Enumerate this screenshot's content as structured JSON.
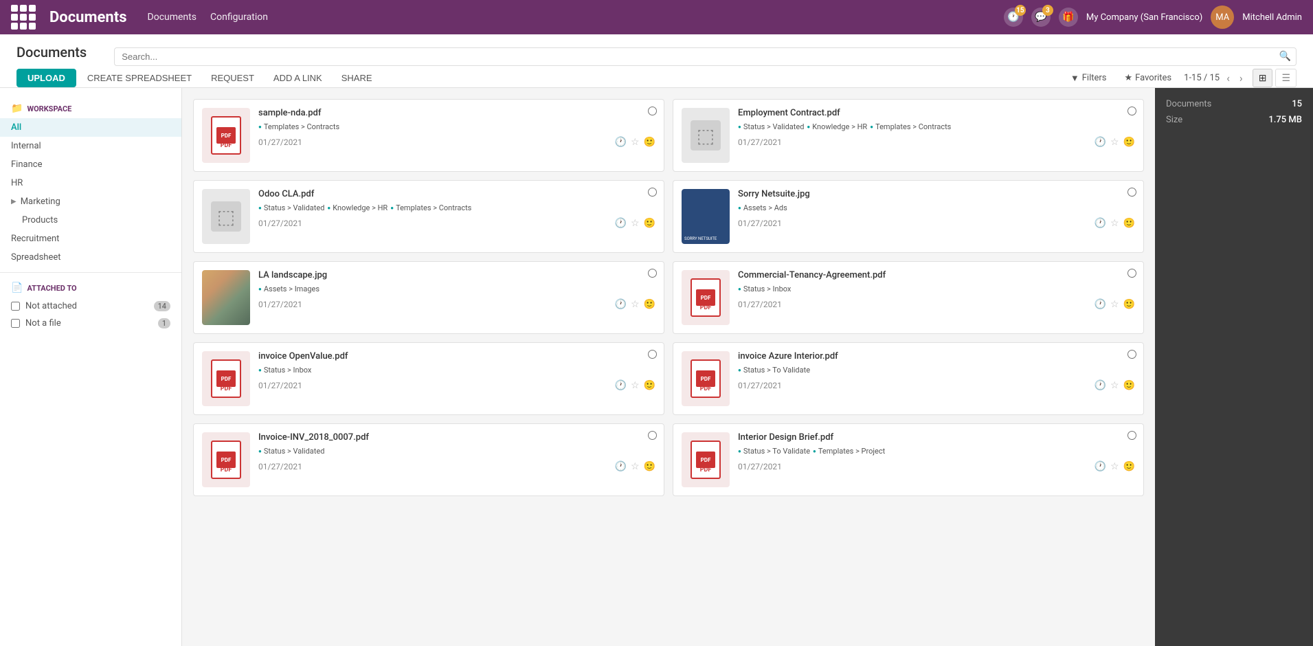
{
  "app": {
    "title": "Documents",
    "nav_links": [
      "Documents",
      "Configuration"
    ]
  },
  "topnav": {
    "company": "My Company (San Francisco)",
    "username": "Mitchell Admin",
    "badge1_count": "15",
    "badge2_count": "3"
  },
  "page": {
    "title": "Documents",
    "search_placeholder": "Search..."
  },
  "toolbar": {
    "upload_label": "UPLOAD",
    "create_spreadsheet_label": "CREATE SPREADSHEET",
    "request_label": "REQUEST",
    "add_link_label": "ADD A LINK",
    "share_label": "SHARE",
    "filters_label": "Filters",
    "favorites_label": "Favorites",
    "pagination": "1-15 / 15"
  },
  "sidebar": {
    "workspace_title": "WORKSPACE",
    "items": [
      {
        "label": "All",
        "active": true
      },
      {
        "label": "Internal",
        "active": false
      },
      {
        "label": "Finance",
        "active": false
      },
      {
        "label": "HR",
        "active": false
      },
      {
        "label": "Marketing",
        "active": false,
        "has_arrow": true
      },
      {
        "label": "Products",
        "active": false
      },
      {
        "label": "Recruitment",
        "active": false
      },
      {
        "label": "Spreadsheet",
        "active": false
      }
    ],
    "attached_to_title": "ATTACHED TO",
    "attached_items": [
      {
        "label": "Not attached",
        "count": "14"
      },
      {
        "label": "Not a file",
        "count": "1"
      }
    ]
  },
  "right_panel": {
    "documents_label": "Documents",
    "documents_value": "15",
    "size_label": "Size",
    "size_value": "1.75 MB"
  },
  "documents": [
    {
      "id": 1,
      "title": "sample-nda.pdf",
      "type": "pdf",
      "tags": [
        "Templates > Contracts"
      ],
      "date": "01/27/2021"
    },
    {
      "id": 2,
      "title": "Employment Contract.pdf",
      "type": "box",
      "tags": [
        "Status > Validated",
        "Knowledge > HR",
        "Templates > Contracts"
      ],
      "date": "01/27/2021"
    },
    {
      "id": 3,
      "title": "Odoo CLA.pdf",
      "type": "box",
      "tags": [
        "Status > Validated",
        "Knowledge > HR",
        "Templates > Contracts"
      ],
      "date": "01/27/2021"
    },
    {
      "id": 4,
      "title": "Sorry Netsuite.jpg",
      "type": "netsuite",
      "tags": [
        "Assets > Ads"
      ],
      "date": "01/27/2021"
    },
    {
      "id": 5,
      "title": "LA landscape.jpg",
      "type": "landscape",
      "tags": [
        "Assets > Images"
      ],
      "date": "01/27/2021"
    },
    {
      "id": 6,
      "title": "Commercial-Tenancy-Agreement.pdf",
      "type": "pdf",
      "tags": [
        "Status > Inbox"
      ],
      "date": "01/27/2021"
    },
    {
      "id": 7,
      "title": "invoice OpenValue.pdf",
      "type": "pdf",
      "tags": [
        "Status > Inbox"
      ],
      "date": "01/27/2021"
    },
    {
      "id": 8,
      "title": "invoice Azure Interior.pdf",
      "type": "pdf",
      "tags": [
        "Status > To Validate"
      ],
      "date": "01/27/2021"
    },
    {
      "id": 9,
      "title": "Invoice-INV_2018_0007.pdf",
      "type": "pdf",
      "tags": [
        "Status > Validated"
      ],
      "date": "01/27/2021"
    },
    {
      "id": 10,
      "title": "Interior Design Brief.pdf",
      "type": "pdf",
      "tags": [
        "Status > To Validate",
        "Templates > Project"
      ],
      "date": "01/27/2021"
    }
  ]
}
